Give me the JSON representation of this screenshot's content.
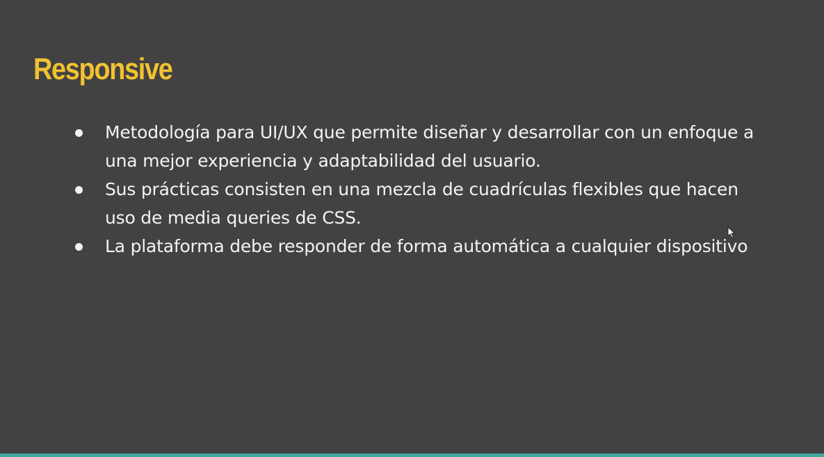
{
  "slide": {
    "title": "Responsive",
    "bullets": [
      "Metodología para UI/UX que permite diseñar y desarrollar con un enfoque a una mejor experiencia y adaptabilidad del usuario.",
      "Sus prácticas consisten en una mezcla de cuadrículas flexibles que hacen uso de media queries de CSS.",
      "La plataforma debe responder de forma automática a cualquier dispositivo"
    ]
  },
  "colors": {
    "background": "#424242",
    "title": "#f1c232",
    "text": "#f3f3f3",
    "accent_bar": "#3fa79a"
  },
  "icons": {
    "cursor": "mouse-pointer-icon"
  }
}
